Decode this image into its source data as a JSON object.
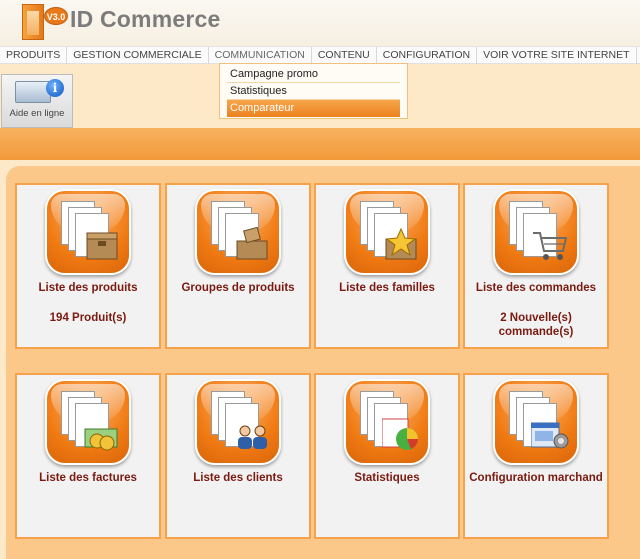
{
  "app": {
    "version": "V3.0",
    "brand": "ID Commerce"
  },
  "nav": [
    {
      "label": "PRODUITS"
    },
    {
      "label": "GESTION COMMERCIALE"
    },
    {
      "label": "COMMUNICATION"
    },
    {
      "label": "CONTENU"
    },
    {
      "label": "CONFIGURATION"
    },
    {
      "label": "VOIR VOTRE SITE INTERNET"
    }
  ],
  "dropdown": [
    {
      "label": "Campagne promo"
    },
    {
      "label": "Statistiques"
    },
    {
      "label": "Comparateur"
    }
  ],
  "help": {
    "label": "Aide en ligne"
  },
  "cards": [
    {
      "title": "Liste des produits",
      "sub": "194 Produit(s)",
      "icon": "product-box-icon"
    },
    {
      "title": "Groupes de produits",
      "sub": "",
      "icon": "product-group-icon"
    },
    {
      "title": "Liste des familles",
      "sub": "",
      "icon": "family-star-icon"
    },
    {
      "title": "Liste des commandes",
      "sub": "2 Nouvelle(s) commande(s)",
      "icon": "shopping-cart-icon"
    },
    {
      "title": "Liste des factures",
      "sub": "",
      "icon": "invoice-money-icon"
    },
    {
      "title": "Liste des clients",
      "sub": "",
      "icon": "customers-icon"
    },
    {
      "title": "Statistiques",
      "sub": "",
      "icon": "pie-chart-icon"
    },
    {
      "title": "Configuration marchand",
      "sub": "",
      "icon": "settings-gear-icon"
    }
  ]
}
